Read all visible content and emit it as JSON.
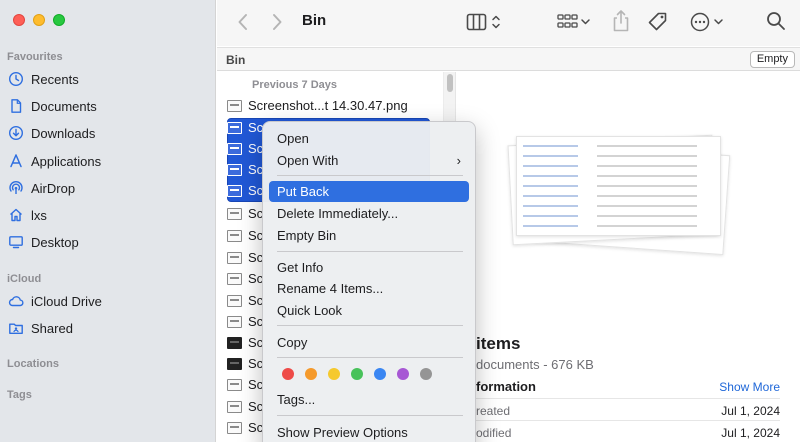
{
  "sidebar": {
    "favourites_header": "Favourites",
    "icloud_header": "iCloud",
    "locations_header": "Locations",
    "tags_header": "Tags",
    "items": [
      {
        "label": "Recents",
        "icon": "clock-icon"
      },
      {
        "label": "Documents",
        "icon": "document-icon"
      },
      {
        "label": "Downloads",
        "icon": "download-icon"
      },
      {
        "label": "Applications",
        "icon": "applications-icon"
      },
      {
        "label": "AirDrop",
        "icon": "airdrop-icon"
      },
      {
        "label": "lxs",
        "icon": "home-icon"
      },
      {
        "label": "Desktop",
        "icon": "desktop-icon"
      }
    ],
    "icloud_items": [
      {
        "label": "iCloud Drive",
        "icon": "cloud-icon"
      },
      {
        "label": "Shared",
        "icon": "shared-folder-icon"
      }
    ]
  },
  "toolbar": {
    "title": "Bin"
  },
  "pathbar": {
    "title": "Bin",
    "empty_label": "Empty"
  },
  "file_list": {
    "section_header": "Previous 7 Days",
    "first_file": "Screenshot...t 14.30.47.png",
    "selected_prefix": "Sc",
    "row_prefix": "Sc"
  },
  "preview": {
    "title": "items",
    "subtitle": "documents - 676 KB",
    "info_header": "formation",
    "show_more": "Show More",
    "rows": [
      {
        "key": "reated",
        "value": "Jul 1, 2024"
      },
      {
        "key": "odified",
        "value": "Jul 1, 2024"
      }
    ]
  },
  "context_menu": {
    "open": "Open",
    "open_with": "Open With",
    "submenu_arrow": "›",
    "put_back": "Put Back",
    "delete_immediately": "Delete Immediately...",
    "empty_bin": "Empty Bin",
    "get_info": "Get Info",
    "rename": "Rename 4 Items...",
    "quick_look": "Quick Look",
    "copy": "Copy",
    "tags": "Tags...",
    "show_preview_options": "Show Preview Options",
    "tag_colors": [
      "#ee4b48",
      "#f59a2c",
      "#f5c92e",
      "#48c25a",
      "#3a86f2",
      "#a757d4",
      "#959595"
    ]
  },
  "colors": {
    "accent": "#2f6fe0",
    "selection": "#2158d6"
  }
}
